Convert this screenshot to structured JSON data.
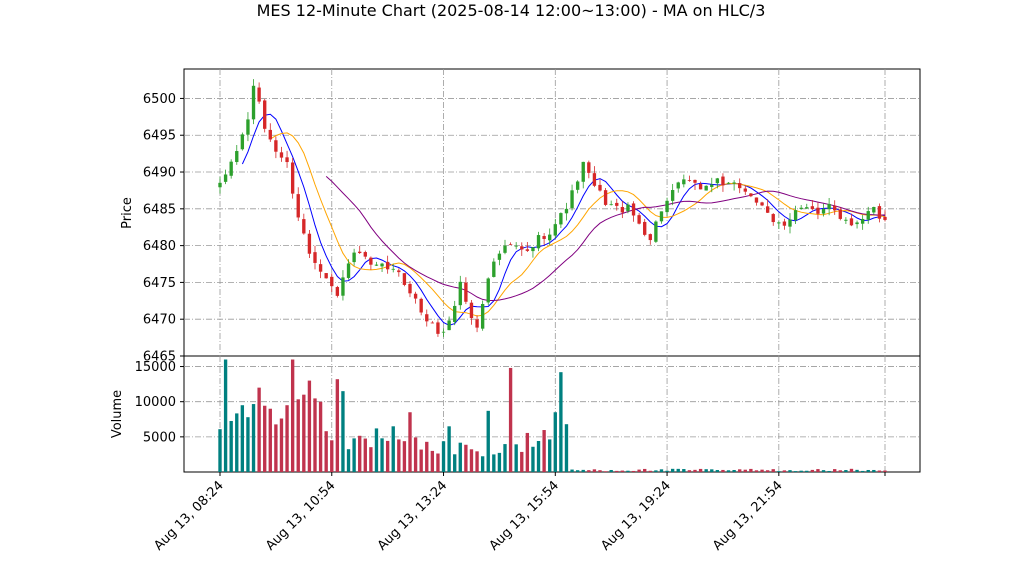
{
  "chart_data": {
    "type": "candlestick",
    "title": "MES 12-Minute Chart (2025-08-14 12:00~13:00) - MA on HLC/3",
    "price_panel": {
      "ylabel": "Price",
      "ylim": [
        6465,
        6504
      ],
      "yticks": [
        "6465",
        "6470",
        "6475",
        "6480",
        "6485",
        "6490",
        "6495",
        "6500"
      ],
      "grid": true
    },
    "volume_panel": {
      "ylabel": "Volume",
      "ylim": [
        0,
        16500
      ],
      "yticks": [
        "5000",
        "10000",
        "15000"
      ],
      "grid": true
    },
    "xtick_labels": [
      "Aug 13, 08:24",
      "Aug 13, 10:54",
      "Aug 13, 13:24",
      "Aug 13, 15:54",
      "Aug 13, 19:24",
      "Aug 13, 21:54"
    ],
    "n_bars": 120,
    "price_anchors": [
      {
        "i": 0,
        "p": 6488
      },
      {
        "i": 3,
        "p": 6493
      },
      {
        "i": 5,
        "p": 6497
      },
      {
        "i": 6,
        "p": 6502
      },
      {
        "i": 8,
        "p": 6496
      },
      {
        "i": 10,
        "p": 6493
      },
      {
        "i": 12,
        "p": 6491
      },
      {
        "i": 14,
        "p": 6484
      },
      {
        "i": 16,
        "p": 6479
      },
      {
        "i": 19,
        "p": 6476
      },
      {
        "i": 21,
        "p": 6473
      },
      {
        "i": 23,
        "p": 6478
      },
      {
        "i": 25,
        "p": 6479
      },
      {
        "i": 27,
        "p": 6477
      },
      {
        "i": 30,
        "p": 6477
      },
      {
        "i": 32,
        "p": 6476
      },
      {
        "i": 34,
        "p": 6474
      },
      {
        "i": 36,
        "p": 6471
      },
      {
        "i": 38,
        "p": 6469
      },
      {
        "i": 40,
        "p": 6468
      },
      {
        "i": 42,
        "p": 6472
      },
      {
        "i": 43,
        "p": 6475
      },
      {
        "i": 45,
        "p": 6470
      },
      {
        "i": 46,
        "p": 6469
      },
      {
        "i": 48,
        "p": 6476
      },
      {
        "i": 50,
        "p": 6479
      },
      {
        "i": 52,
        "p": 6480
      },
      {
        "i": 55,
        "p": 6479
      },
      {
        "i": 57,
        "p": 6481
      },
      {
        "i": 59,
        "p": 6482
      },
      {
        "i": 61,
        "p": 6484
      },
      {
        "i": 63,
        "p": 6487
      },
      {
        "i": 64,
        "p": 6489
      },
      {
        "i": 65,
        "p": 6491
      },
      {
        "i": 67,
        "p": 6488
      },
      {
        "i": 69,
        "p": 6486
      },
      {
        "i": 71,
        "p": 6485
      },
      {
        "i": 73,
        "p": 6485
      },
      {
        "i": 75,
        "p": 6483
      },
      {
        "i": 77,
        "p": 6481
      },
      {
        "i": 79,
        "p": 6485
      },
      {
        "i": 81,
        "p": 6487
      },
      {
        "i": 83,
        "p": 6489
      },
      {
        "i": 85,
        "p": 6488
      },
      {
        "i": 87,
        "p": 6488
      },
      {
        "i": 89,
        "p": 6489
      },
      {
        "i": 91,
        "p": 6488
      },
      {
        "i": 93,
        "p": 6488
      },
      {
        "i": 95,
        "p": 6487
      },
      {
        "i": 97,
        "p": 6485
      },
      {
        "i": 99,
        "p": 6483
      },
      {
        "i": 101,
        "p": 6483
      },
      {
        "i": 103,
        "p": 6485
      },
      {
        "i": 105,
        "p": 6485
      },
      {
        "i": 107,
        "p": 6484
      },
      {
        "i": 109,
        "p": 6486
      },
      {
        "i": 111,
        "p": 6484
      },
      {
        "i": 113,
        "p": 6483
      },
      {
        "i": 115,
        "p": 6484
      },
      {
        "i": 117,
        "p": 6485
      },
      {
        "i": 119,
        "p": 6483
      }
    ],
    "volume_profile": [
      {
        "from": 0,
        "to": 20,
        "base": 7000,
        "amp": 6000
      },
      {
        "from": 20,
        "to": 38,
        "base": 4000,
        "amp": 2500
      },
      {
        "from": 38,
        "to": 55,
        "base": 3000,
        "amp": 2500
      },
      {
        "from": 55,
        "to": 62,
        "base": 4500,
        "amp": 3000
      },
      {
        "from": 62,
        "to": 120,
        "base": 250,
        "amp": 350
      }
    ],
    "volume_spikes": [
      {
        "i": 1,
        "v": 16000
      },
      {
        "i": 4,
        "v": 9500
      },
      {
        "i": 7,
        "v": 12000
      },
      {
        "i": 9,
        "v": 9000
      },
      {
        "i": 12,
        "v": 9500
      },
      {
        "i": 13,
        "v": 16000
      },
      {
        "i": 15,
        "v": 11000
      },
      {
        "i": 16,
        "v": 13000
      },
      {
        "i": 21,
        "v": 13200
      },
      {
        "i": 22,
        "v": 11500
      },
      {
        "i": 28,
        "v": 6200
      },
      {
        "i": 31,
        "v": 6500
      },
      {
        "i": 34,
        "v": 8500
      },
      {
        "i": 41,
        "v": 6500
      },
      {
        "i": 48,
        "v": 8700
      },
      {
        "i": 52,
        "v": 14800
      },
      {
        "i": 60,
        "v": 8500
      },
      {
        "i": 61,
        "v": 14200
      },
      {
        "i": 62,
        "v": 6800
      }
    ],
    "moving_averages": [
      {
        "period": 5,
        "color": "#0000ff"
      },
      {
        "period": 10,
        "color": "#ffa500"
      },
      {
        "period": 20,
        "color": "#800080"
      }
    ],
    "colors": {
      "up": "#2ca02c",
      "down": "#d62728",
      "vol_up": "#008080",
      "vol_down": "#c0334d"
    }
  }
}
